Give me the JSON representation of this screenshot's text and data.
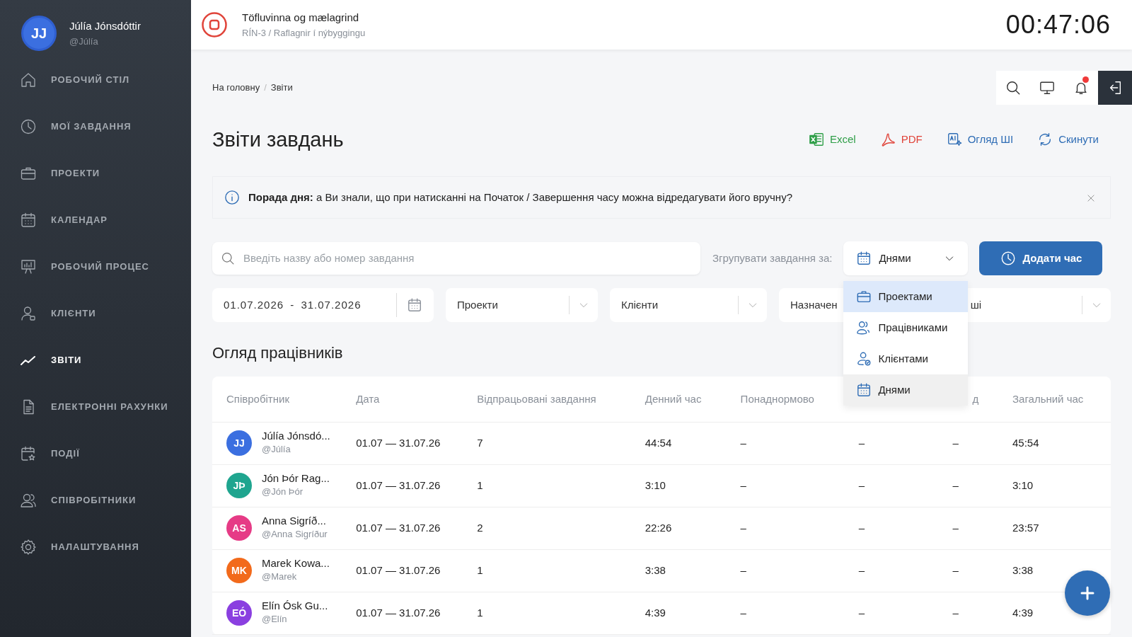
{
  "user": {
    "initials": "JJ",
    "name": "Júlía Jónsdóttir",
    "handle": "@Júlía"
  },
  "sidebar": {
    "items": [
      {
        "label": "РОБОЧИЙ СТІЛ",
        "selected": false
      },
      {
        "label": "МОЇ ЗАВДАННЯ",
        "selected": false
      },
      {
        "label": "ПРОЕКТИ",
        "selected": false
      },
      {
        "label": "КАЛЕНДАР",
        "selected": false
      },
      {
        "label": "РОБОЧИЙ ПРОЦЕС",
        "selected": false
      },
      {
        "label": "КЛІЄНТИ",
        "selected": false
      },
      {
        "label": "ЗВІТИ",
        "selected": true
      },
      {
        "label": "ЕЛЕКТРОННІ РАХУНКИ",
        "selected": false
      },
      {
        "label": "ПОДІЇ",
        "selected": false
      },
      {
        "label": "СПІВРОБІТНИКИ",
        "selected": false
      },
      {
        "label": "НАЛАШТУВАННЯ",
        "selected": false
      }
    ]
  },
  "timer_bar": {
    "task": "Töfluvinna og mælagrind",
    "path": "RÍN-3 / Raflagnir í nýbyggingu",
    "elapsed": "00:47:06"
  },
  "breadcrumb": [
    "На головну",
    "Звіти"
  ],
  "breadcrumb_separator": "/",
  "toolbar": {
    "notification": true
  },
  "page_title": "Звіти завдань",
  "actions": [
    {
      "label": "Excel",
      "color": "#2e9e47"
    },
    {
      "label": "PDF",
      "color": "#e0443a"
    },
    {
      "label": "Огляд ШІ",
      "color": "#2f6db5"
    },
    {
      "label": "Скинути",
      "color": "#2f6db5"
    }
  ],
  "tip": {
    "text": "**Порада дня:** а Ви знали, що при натисканні на Початок / Завершення часу можна відредагувати його вручну?"
  },
  "search": {
    "placeholder": "Введіть назву або номер завдання"
  },
  "group_by": {
    "label": "Згрупувати завдання за:",
    "value": "Днями",
    "expanded": true,
    "options": [
      {
        "label": "Проектами",
        "selected": false,
        "highlighted": true
      },
      {
        "label": "Працівниками",
        "selected": false,
        "highlighted": false
      },
      {
        "label": "Клієнтами",
        "selected": false,
        "highlighted": false
      },
      {
        "label": "Днями",
        "selected": true,
        "highlighted": false
      }
    ]
  },
  "add_button": "Додати час",
  "filters": [
    {
      "kind": "date",
      "value": "01.07.2026 - 31.07.2026"
    },
    {
      "kind": "select",
      "placeholder": "Проекти"
    },
    {
      "kind": "select",
      "placeholder": "Клієнти"
    },
    {
      "kind": "select",
      "placeholder": "Назначен",
      "placeholder_end": "ші"
    }
  ],
  "section_title": "Огляд працівників",
  "table": {
    "employee_column": "Співробітник",
    "columns": [
      {
        "label": "Дата"
      },
      {
        "label": "Відпрацьовані завдання"
      },
      {
        "label": "Денний час"
      },
      {
        "label": "Понаднормово"
      },
      {
        "covered": true
      },
      {
        "label": "д"
      },
      {
        "label": "Загальний час"
      }
    ],
    "rows": [
      {
        "initials": "JJ",
        "color": "#3b6fe0",
        "name": "Júlía Jónsdó...",
        "handle": "@Júlía",
        "cells": [
          "01.07 — 31.07.26",
          "7",
          "44:54",
          "–",
          "–",
          "–",
          "45:54"
        ]
      },
      {
        "initials": "JÞ",
        "color": "#1fa58f",
        "name": "Jón Þór Rag...",
        "handle": "@Jón Þór",
        "cells": [
          "01.07 — 31.07.26",
          "1",
          "3:10",
          "–",
          "–",
          "–",
          "3:10"
        ]
      },
      {
        "initials": "AS",
        "color": "#e63b86",
        "name": "Anna Sigríð...",
        "handle": "@Anna Sigríður",
        "cells": [
          "01.07 — 31.07.26",
          "2",
          "22:26",
          "–",
          "–",
          "–",
          "23:57"
        ]
      },
      {
        "initials": "MK",
        "color": "#f26a1b",
        "name": "Marek Kowa...",
        "handle": "@Marek",
        "cells": [
          "01.07 — 31.07.26",
          "1",
          "3:38",
          "–",
          "–",
          "–",
          "3:38"
        ]
      },
      {
        "initials": "EÓ",
        "color": "#8a3fe0",
        "name": "Elín Ósk Gu...",
        "handle": "@Elín",
        "cells": [
          "01.07 — 31.07.26",
          "1",
          "4:39",
          "–",
          "–",
          "–",
          "4:39"
        ]
      }
    ]
  }
}
